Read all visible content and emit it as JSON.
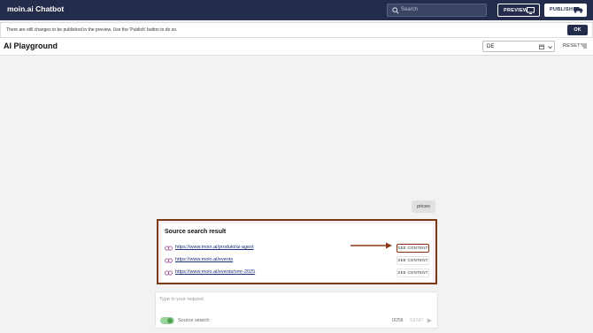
{
  "topbar": {
    "brand": "moin.ai Chatbot",
    "search_placeholder": "Search",
    "preview_label": "PREVIEW",
    "publish_label": "PUBLISH"
  },
  "notice": {
    "text": "There are still changes to be published in the preview. Use the 'Publish' button to do so.",
    "ok_label": "OK"
  },
  "header": {
    "title": "AI Playground",
    "language": "DE",
    "reset_label": "RESET"
  },
  "chat": {
    "user_message": "prices"
  },
  "source_result": {
    "title": "Source search result",
    "see_content_label": "SEE CONTENT",
    "links": [
      "https://www.moin.ai/produkt/ai-agent",
      "https://www.moin.ai/events",
      "https://www.moin.ai/events/omr-2025"
    ]
  },
  "input": {
    "placeholder": "Type in your request",
    "toggle_label": "Source search",
    "toggle_on": true,
    "counter": "0/256",
    "send_label": "SEND"
  },
  "colors": {
    "topbar": "#232c4a",
    "highlight": "#7a3a12",
    "link": "#1e2d7a",
    "toggle": "#4c9e53"
  }
}
